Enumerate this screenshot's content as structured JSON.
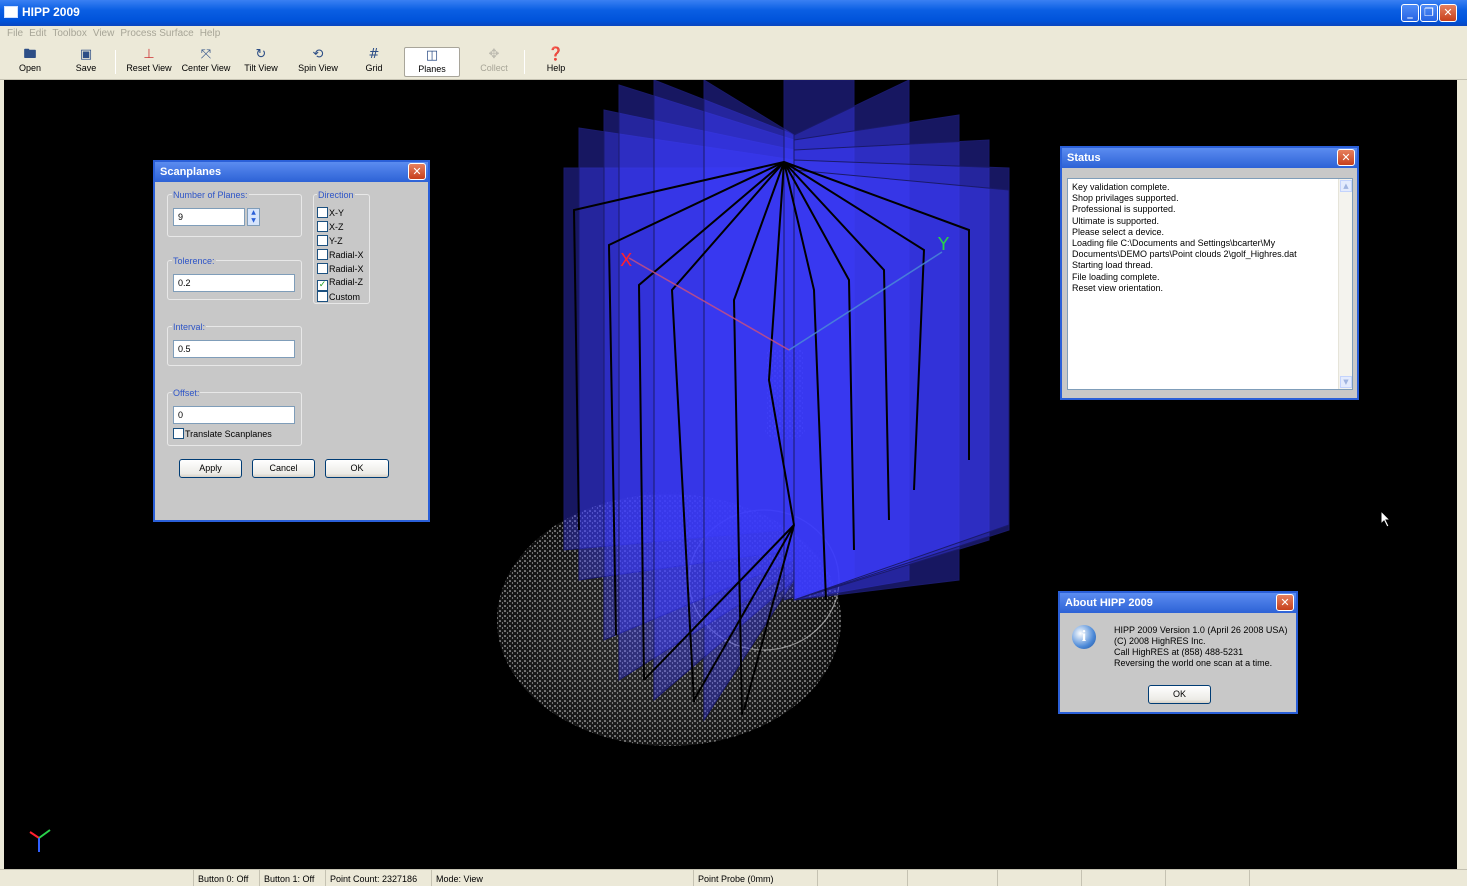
{
  "window": {
    "title": "HIPP 2009",
    "min_label": "_",
    "restore_label": "❐",
    "close_label": "✕"
  },
  "menu": [
    "File",
    "Edit",
    "Toolbox",
    "View",
    "Process Surface",
    "Help"
  ],
  "toolbar": {
    "open": "Open",
    "save": "Save",
    "reset_view": "Reset View",
    "center_view": "Center View",
    "tilt_view": "Tilt View",
    "spin_view": "Spin View",
    "grid": "Grid",
    "planes": "Planes",
    "collect": "Collect",
    "help": "Help"
  },
  "scene": {
    "axis_x": "X",
    "axis_y": "Y"
  },
  "scanplanes": {
    "title": "Scanplanes",
    "num_planes_label": "Number of Planes:",
    "num_planes_value": "9",
    "tolerance_label": "Tolerence:",
    "tolerance_value": "0.2",
    "interval_label": "Interval:",
    "interval_value": "0.5",
    "offset_label": "Offset:",
    "offset_value": "0",
    "translate_label": "Translate Scanplanes",
    "direction_label": "Direction",
    "directions": [
      {
        "label": "X-Y",
        "checked": false
      },
      {
        "label": "X-Z",
        "checked": false
      },
      {
        "label": "Y-Z",
        "checked": false
      },
      {
        "label": "Radial-X",
        "checked": false
      },
      {
        "label": "Radial-X",
        "checked": false
      },
      {
        "label": "Radial-Z",
        "checked": true
      },
      {
        "label": "Custom",
        "checked": false
      }
    ],
    "apply": "Apply",
    "cancel": "Cancel",
    "ok": "OK"
  },
  "status": {
    "title": "Status",
    "lines": [
      "Key validation complete.",
      "Shop privilages supported.",
      "Professional is supported.",
      "Ultimate is supported.",
      "Please select a device.",
      "Loading file C:\\Documents and Settings\\bcarter\\My",
      "Documents\\DEMO  parts\\Point clouds 2\\golf_Highres.dat",
      "Starting load thread.",
      "File loading complete.",
      "Reset view orientation."
    ]
  },
  "about": {
    "title": "About HIPP 2009",
    "lines": [
      "HIPP 2009 Version 1.0 (April 26 2008 USA)",
      "(C) 2008 HighRES Inc.",
      "Call HighRES at (858) 488-5231",
      "Reversing the world one scan at a time."
    ],
    "ok": "OK"
  },
  "statusbar": {
    "button0": "Button 0: Off",
    "button1": "Button 1: Off",
    "point_count": "Point Count: 2327186",
    "mode": "Mode: View",
    "probe": "Point Probe (0mm)"
  }
}
